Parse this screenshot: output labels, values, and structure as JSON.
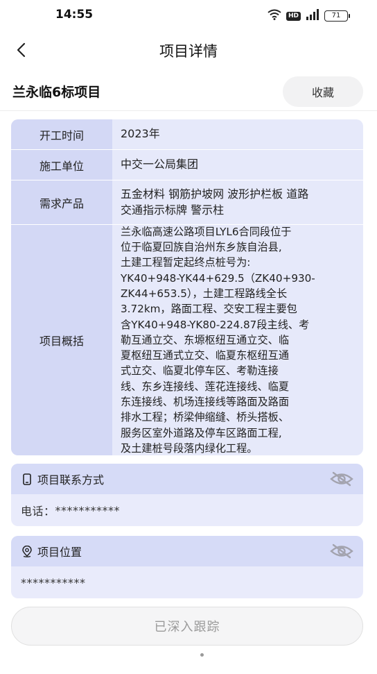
{
  "status_bar": {
    "time": "14:55",
    "hd": "HD",
    "battery": "71"
  },
  "nav": {
    "title": "项目详情"
  },
  "project": {
    "name": "兰永临6标项目",
    "favorite_label": "收藏"
  },
  "info": {
    "start_time": {
      "label": "开工时间",
      "value": "2023年"
    },
    "builder": {
      "label": "施工单位",
      "value": "中交一公局集团"
    },
    "products": {
      "label": "需求产品",
      "lines": [
        "五金材料 钢筋护坡网 波形护栏板 道路",
        "交通指示标牌 警示柱"
      ]
    },
    "overview": {
      "label": "项目概括",
      "lines": [
        "兰永临高速公路项目LYL6合同段位于",
        "位于临夏回族自治州东乡族自治县,",
        "土建工程暂定起终点桩号为:",
        "YK40+948-YK44+629.5（ZK40+930-",
        "ZK44+653.5），土建工程路线全长",
        "3.72km，路面工程、交安工程主要包",
        "含YK40+948-YK80-224.87段主线、考",
        "勒互通立交、东塬枢纽互通立交、临",
        "夏枢纽互通式立交、临夏东枢纽互通",
        "式立交、临夏北停车区、考勒连接",
        "线、东乡连接线、莲花连接线、临夏",
        "东连接线、机场连接线等路面及路面",
        "排水工程；桥梁伸缩缝、桥头搭板、",
        "服务区室外道路及停车区路面工程,",
        "及土建桩号段落内绿化工程。"
      ]
    }
  },
  "contact": {
    "title": "项目联系方式",
    "phone_label": "电话：",
    "phone_value": "***********"
  },
  "location": {
    "title": "项目位置",
    "value": "***********"
  },
  "actions": {
    "track_label": "已深入跟踪"
  },
  "colors": {
    "label_bg": "#d3d8f5",
    "value_bg": "#e6e9fa",
    "card_head_bg": "#d6dbf7"
  }
}
